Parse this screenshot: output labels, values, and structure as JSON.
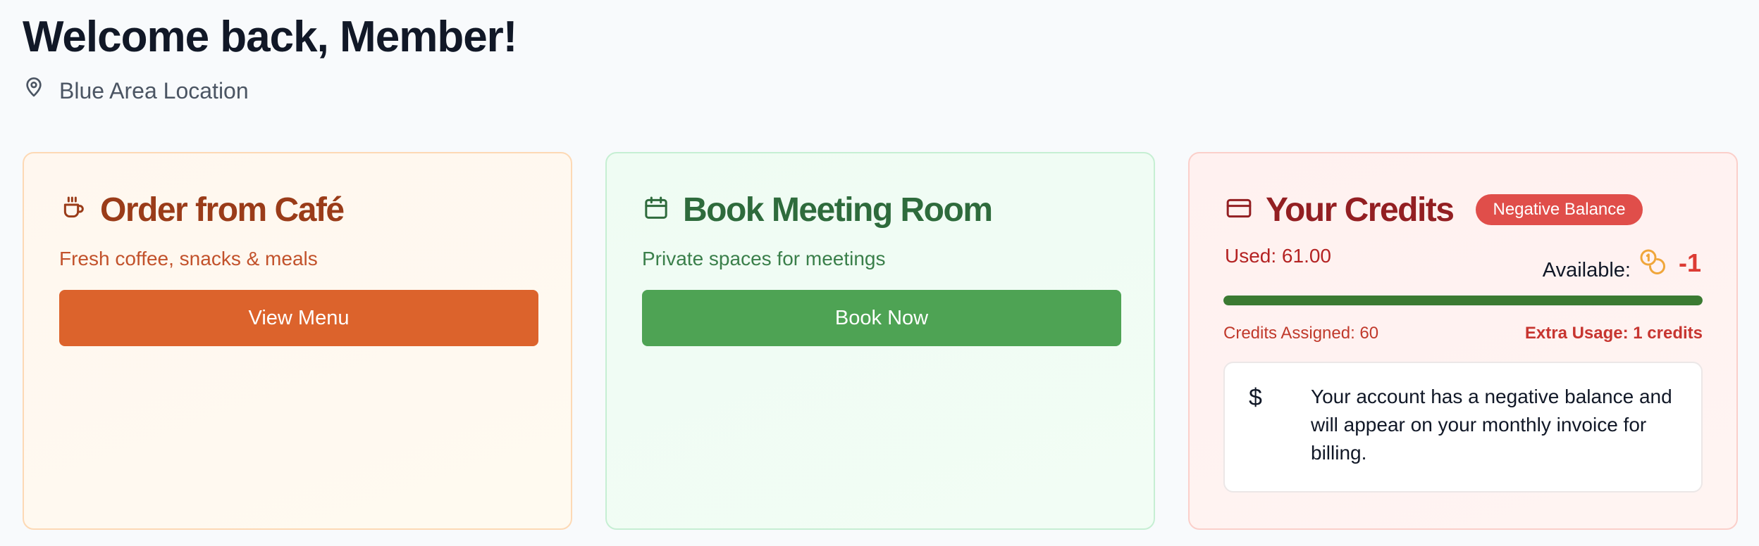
{
  "header": {
    "greeting": "Welcome back, Member!",
    "location": "Blue Area Location"
  },
  "cafe": {
    "title": "Order from Café",
    "subtitle": "Fresh coffee, snacks & meals",
    "button": "View Menu",
    "icon": "coffee-cup-icon",
    "accent": "#dc632c"
  },
  "room": {
    "title": "Book Meeting Room",
    "subtitle": "Private spaces for meetings",
    "button": "Book Now",
    "icon": "calendar-icon",
    "accent": "#4ea354"
  },
  "credits": {
    "title": "Your Credits",
    "badge": "Negative Balance",
    "used": "Used: 61.00",
    "available_label": "Available:",
    "available_value": "-1",
    "progress": 1.0,
    "assigned": "Credits Assigned: 60",
    "extra": "Extra Usage: 1 credits",
    "notice": "Your account has a negative balance and will appear on your monthly invoice for billing.",
    "icon": "credit-card-icon",
    "accent": "#e04e4a"
  }
}
